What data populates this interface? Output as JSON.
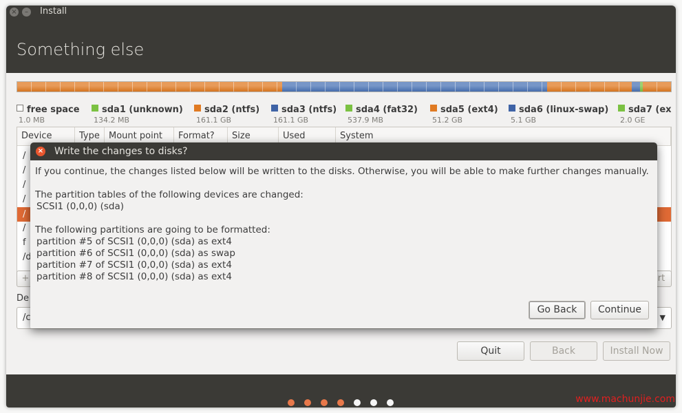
{
  "window": {
    "title": "Install"
  },
  "header": {
    "title": "Something else"
  },
  "partition_bar": [
    {
      "color": "#e07a22",
      "fraction": 0.405
    },
    {
      "color": "#4a73b5",
      "fraction": 0.405
    },
    {
      "color": "#e07a22",
      "fraction": 0.13
    },
    {
      "color": "#4a73b5",
      "fraction": 0.013
    },
    {
      "color": "#7bc142",
      "fraction": 0.004
    },
    {
      "color": "#e07a22",
      "fraction": 0.043
    }
  ],
  "legend": [
    {
      "name": "free space",
      "size": "1.0 MB",
      "color": "#ffffff"
    },
    {
      "name": "sda1 (unknown)",
      "size": "134.2 MB",
      "color": "#7bc142"
    },
    {
      "name": "sda2 (ntfs)",
      "size": "161.1 GB",
      "color": "#e07a22"
    },
    {
      "name": "sda3 (ntfs)",
      "size": "161.1 GB",
      "color": "#3f63a6"
    },
    {
      "name": "sda4 (fat32)",
      "size": "537.9 MB",
      "color": "#7bc142"
    },
    {
      "name": "sda5 (ext4)",
      "size": "51.2 GB",
      "color": "#e07a22"
    },
    {
      "name": "sda6 (linux-swap)",
      "size": "5.1 GB",
      "color": "#3f63a6"
    },
    {
      "name": "sda7 (ex",
      "size": "2.0 GE",
      "color": "#7bc142"
    }
  ],
  "table": {
    "columns": [
      "Device",
      "Type",
      "Mount point",
      "Format?",
      "Size",
      "Used",
      "System"
    ],
    "rows": [
      "/",
      "/",
      "/",
      "/",
      "/",
      "/",
      "f",
      "/d"
    ]
  },
  "background_controls": {
    "add_stub": "+",
    "revert_stub": "rt",
    "device_label_stub": "De",
    "combo_stub": "/c",
    "combo_arrow": "▼"
  },
  "nav": {
    "quit": "Quit",
    "back": "Back",
    "install_now": "Install Now"
  },
  "progress_dots": [
    {
      "color": "#e8784a"
    },
    {
      "color": "#e8784a"
    },
    {
      "color": "#e8784a"
    },
    {
      "color": "#e8784a"
    },
    {
      "color": "#f5f5f5"
    },
    {
      "color": "#f5f5f5"
    },
    {
      "color": "#f5f5f5"
    }
  ],
  "watermark": "www.machunjie.com",
  "dialog": {
    "title": "Write the changes to disks?",
    "intro": "If you continue, the changes listed below will be written to the disks. Otherwise, you will be able to make further changes manually.",
    "tables_heading": "The partition tables of the following devices are changed:",
    "tables_items": [
      "SCSI1 (0,0,0) (sda)"
    ],
    "format_heading": "The following partitions are going to be formatted:",
    "format_items": [
      "partition #5 of SCSI1 (0,0,0) (sda) as ext4",
      "partition #6 of SCSI1 (0,0,0) (sda) as swap",
      "partition #7 of SCSI1 (0,0,0) (sda) as ext4",
      "partition #8 of SCSI1 (0,0,0) (sda) as ext4"
    ],
    "go_back": "Go Back",
    "continue": "Continue"
  }
}
